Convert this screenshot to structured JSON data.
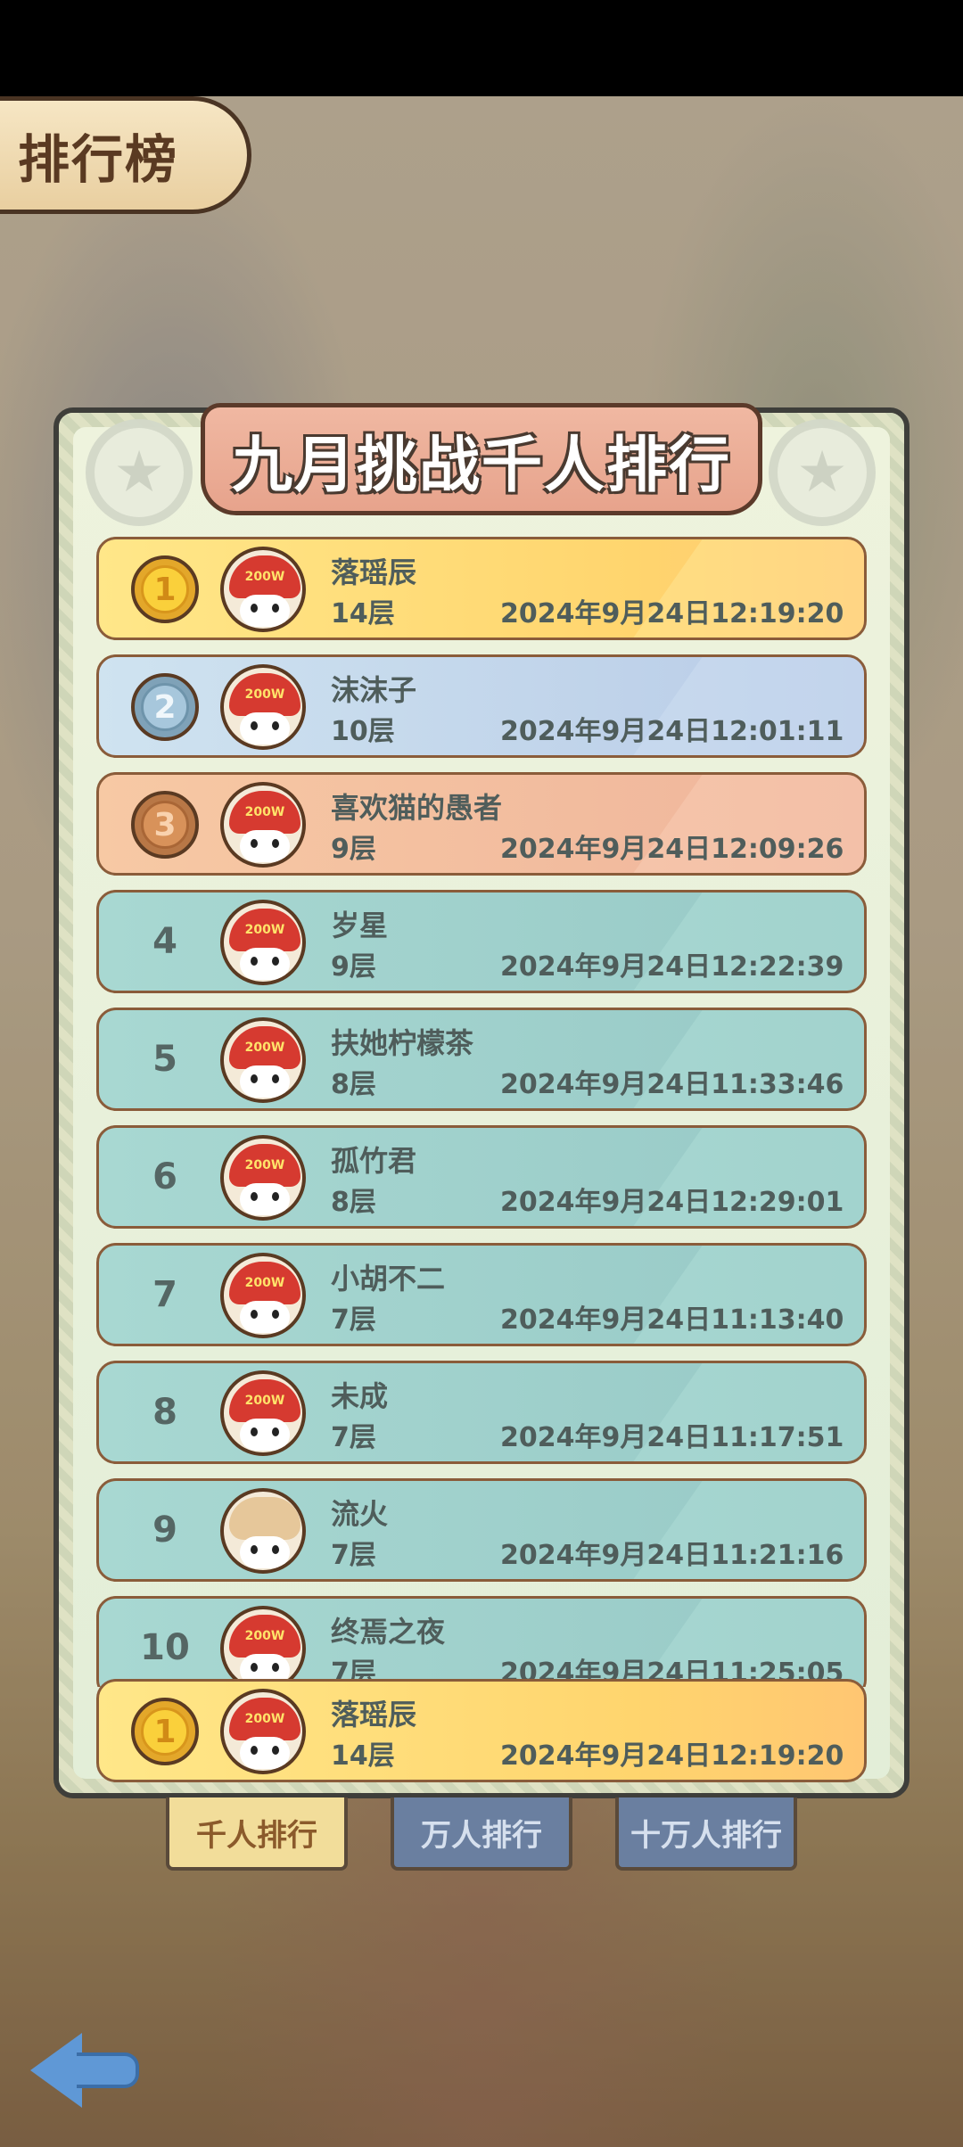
{
  "header": {
    "title": "排行榜"
  },
  "panel": {
    "title": "九月挑战千人排行"
  },
  "rows": [
    {
      "rank": "1",
      "name": "落瑶辰",
      "floor": "14层",
      "time": "2024年9月24日12:19:20",
      "style": "gold",
      "avatar": "cap"
    },
    {
      "rank": "2",
      "name": "沫沫子",
      "floor": "10层",
      "time": "2024年9月24日12:01:11",
      "style": "silver",
      "avatar": "cap"
    },
    {
      "rank": "3",
      "name": "喜欢猫的愚者",
      "floor": "9层",
      "time": "2024年9月24日12:09:26",
      "style": "bronze",
      "avatar": "cap"
    },
    {
      "rank": "4",
      "name": "岁星",
      "floor": "9层",
      "time": "2024年9月24日12:22:39",
      "style": "teal",
      "avatar": "cap"
    },
    {
      "rank": "5",
      "name": "扶她柠檬茶",
      "floor": "8层",
      "time": "2024年9月24日11:33:46",
      "style": "teal",
      "avatar": "cap"
    },
    {
      "rank": "6",
      "name": "孤竹君",
      "floor": "8层",
      "time": "2024年9月24日12:29:01",
      "style": "teal",
      "avatar": "cap"
    },
    {
      "rank": "7",
      "name": "小胡不二",
      "floor": "7层",
      "time": "2024年9月24日11:13:40",
      "style": "teal",
      "avatar": "cap"
    },
    {
      "rank": "8",
      "name": "未成",
      "floor": "7层",
      "time": "2024年9月24日11:17:51",
      "style": "teal",
      "avatar": "cap"
    },
    {
      "rank": "9",
      "name": "流火",
      "floor": "7层",
      "time": "2024年9月24日11:21:16",
      "style": "teal",
      "avatar": "hair"
    },
    {
      "rank": "10",
      "name": "终焉之夜",
      "floor": "7层",
      "time": "2024年9月24日11:25:05",
      "style": "teal",
      "avatar": "cap"
    }
  ],
  "my_rank": {
    "rank": "1",
    "name": "落瑶辰",
    "floor": "14层",
    "time": "2024年9月24日12:19:20"
  },
  "avatar_cap_text": "200W",
  "tabs": [
    {
      "label": "千人排行",
      "active": true
    },
    {
      "label": "万人排行",
      "active": false
    },
    {
      "label": "十万人排行",
      "active": false
    }
  ],
  "icons": {
    "back": "back-arrow-icon",
    "star": "star-icon"
  },
  "colors": {
    "gold": "#ffd56e",
    "silver": "#b8cbe7",
    "bronze": "#efb49b",
    "teal": "#a8d8d2",
    "tab_active": "#f2dd9a",
    "tab_idle": "#6a7fa0"
  }
}
